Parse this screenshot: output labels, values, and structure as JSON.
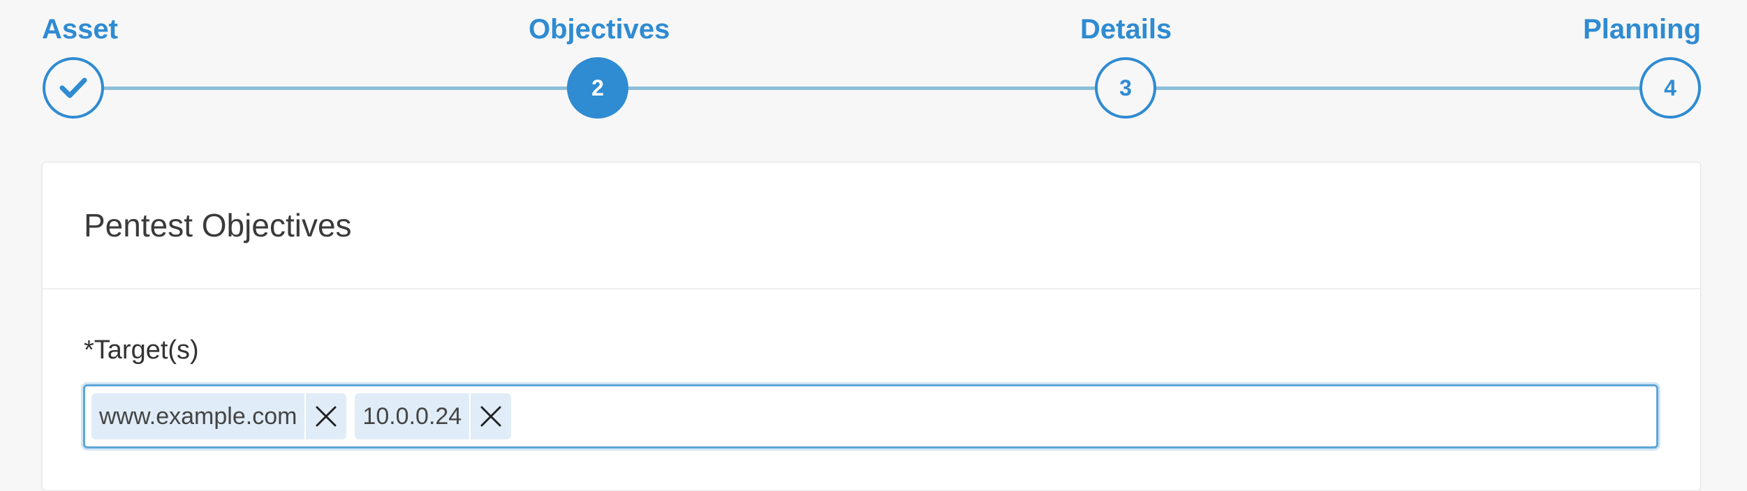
{
  "stepper": {
    "steps": [
      {
        "label": "Asset",
        "marker": "",
        "state": "completed",
        "icon": "check-icon"
      },
      {
        "label": "Objectives",
        "marker": "2",
        "state": "active"
      },
      {
        "label": "Details",
        "marker": "3",
        "state": "upcoming"
      },
      {
        "label": "Planning",
        "marker": "4",
        "state": "upcoming"
      }
    ]
  },
  "card": {
    "title": "Pentest Objectives",
    "targets_field": {
      "label": "*Target(s)",
      "tags": [
        {
          "text": "www.example.com",
          "remove_icon": "close-icon"
        },
        {
          "text": "10.0.0.24",
          "remove_icon": "close-icon"
        }
      ],
      "value": ""
    }
  },
  "colors": {
    "accent": "#2f8bd2",
    "line": "#8cbfd9",
    "tag_bg": "#e0edf8",
    "page_bg": "#f7f7f7"
  }
}
